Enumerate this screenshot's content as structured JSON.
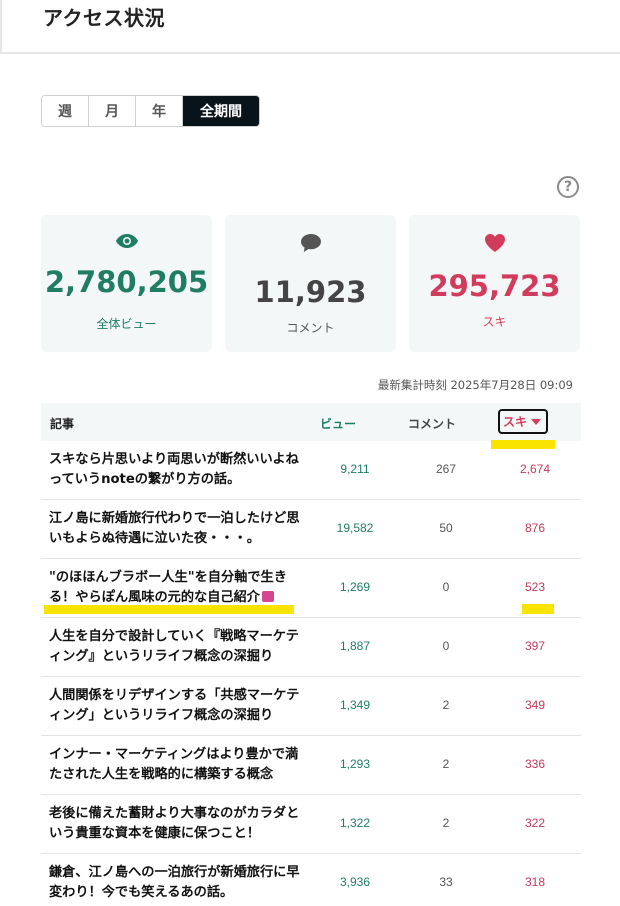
{
  "page": {
    "title": "アクセス状況"
  },
  "period_tabs": [
    {
      "label": "週",
      "active": false
    },
    {
      "label": "月",
      "active": false
    },
    {
      "label": "年",
      "active": false
    },
    {
      "label": "全期間",
      "active": true
    }
  ],
  "help": {
    "glyph": "?"
  },
  "stats": {
    "views": {
      "value": "2,780,205",
      "label": "全体ビュー",
      "icon": "eye-icon"
    },
    "comments": {
      "value": "11,923",
      "label": "コメント",
      "icon": "speech-bubble-icon"
    },
    "likes": {
      "value": "295,723",
      "label": "スキ",
      "icon": "heart-icon"
    }
  },
  "updated_at": "最新集計時刻 2025年7月28日 09:09",
  "table": {
    "headers": {
      "article": "記事",
      "views": "ビュー",
      "comments": "コメント",
      "likes": "スキ"
    },
    "rows": [
      {
        "title": "スキなら片思いより両思いが断然いいよねっていうnoteの繋がり方の話。",
        "views": "9,211",
        "comments": "267",
        "likes": "2,674"
      },
      {
        "title": "江ノ島に新婚旅行代わりで一泊したけど思いもよらぬ待遇に泣いた夜・・・。",
        "views": "19,582",
        "comments": "50",
        "likes": "876"
      },
      {
        "title": "\"のほほんブラボー人生\"を自分軸で生きる！やらぽん風味の元的な自己紹介",
        "views": "1,269",
        "comments": "0",
        "likes": "523"
      },
      {
        "title": "人生を自分で設計していく『戦略マーケティング』というリライフ概念の深掘り",
        "views": "1,887",
        "comments": "0",
        "likes": "397"
      },
      {
        "title": "人間関係をリデザインする「共感マーケティング」というリライフ概念の深掘り",
        "views": "1,349",
        "comments": "2",
        "likes": "349"
      },
      {
        "title": "インナー・マーケティングはより豊かで満たされた人生を戦略的に構築する概念",
        "views": "1,293",
        "comments": "2",
        "likes": "336"
      },
      {
        "title": "老後に備えた蓄財より大事なのがカラダという貴重な資本を健康に保つこと！",
        "views": "1,322",
        "comments": "2",
        "likes": "322"
      },
      {
        "title": "鎌倉、江ノ島への一泊旅行が新婚旅行に早変わり！今でも笑えるあの話。",
        "views": "3,936",
        "comments": "33",
        "likes": "318"
      }
    ]
  },
  "colors": {
    "views": "#1f7d62",
    "likes": "#d23c5c",
    "highlight": "#f9e400",
    "active_tab": "#08131a"
  }
}
